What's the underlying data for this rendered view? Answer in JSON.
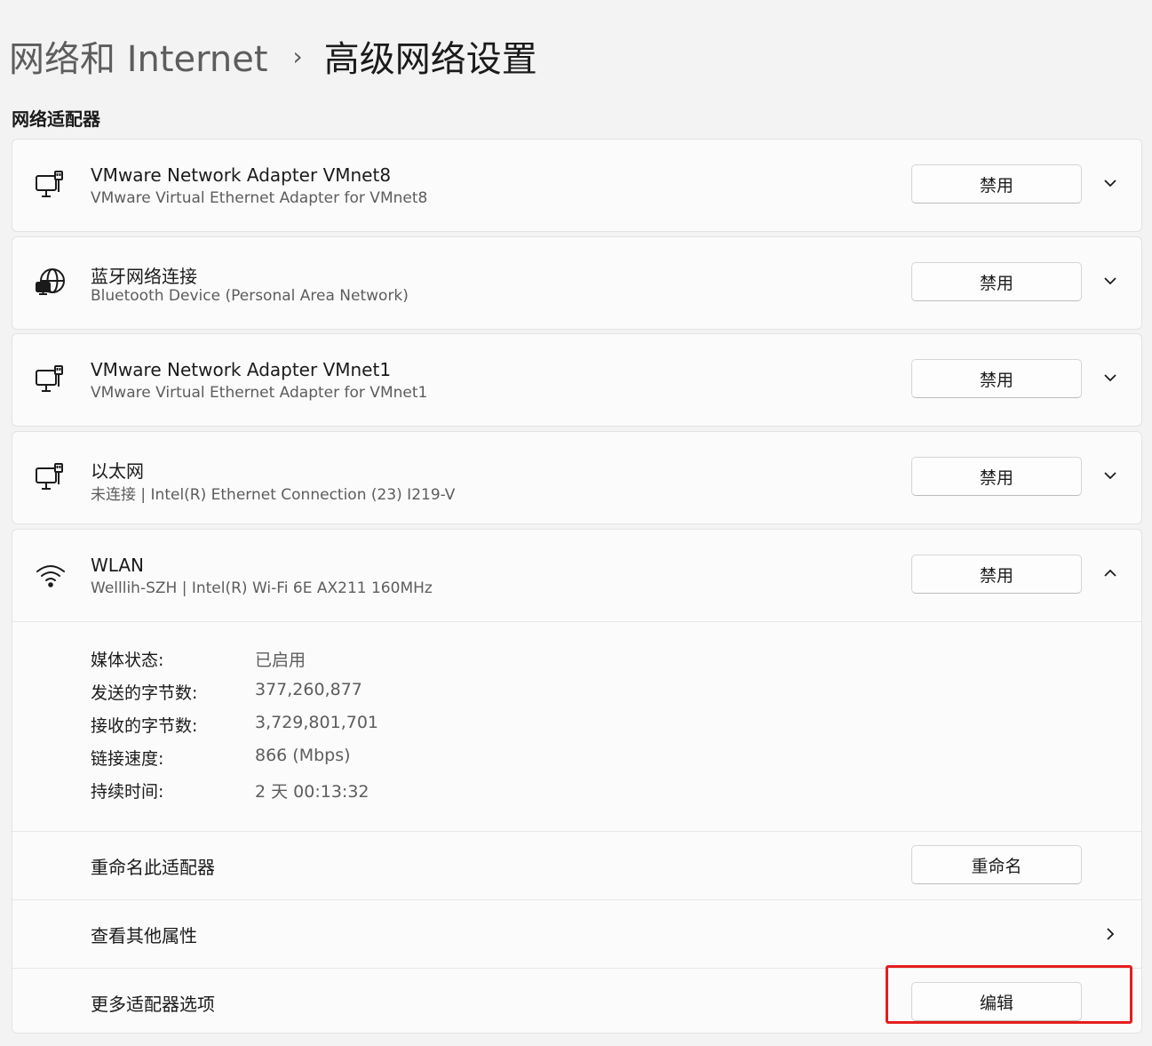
{
  "breadcrumb": {
    "parent": "网络和 Internet",
    "separator": "›",
    "current": "高级网络设置"
  },
  "section_label": "网络适配器",
  "adapters": [
    {
      "icon": "ethernet-adapter-icon",
      "title": "VMware Network Adapter VMnet8",
      "subtitle": "VMware Virtual Ethernet Adapter for VMnet8",
      "button": "禁用",
      "expanded": false
    },
    {
      "icon": "bluetooth-network-icon",
      "title": "蓝牙网络连接",
      "subtitle": "Bluetooth Device (Personal Area Network)",
      "button": "禁用",
      "expanded": false
    },
    {
      "icon": "ethernet-adapter-icon",
      "title": "VMware Network Adapter VMnet1",
      "subtitle": "VMware Virtual Ethernet Adapter for VMnet1",
      "button": "禁用",
      "expanded": false
    },
    {
      "icon": "ethernet-adapter-icon",
      "title": "以太网",
      "subtitle": "未连接 | Intel(R) Ethernet Connection (23) I219-V",
      "button": "禁用",
      "expanded": false
    },
    {
      "icon": "wifi-icon",
      "title": "WLAN",
      "subtitle": "Welllih-SZH | Intel(R) Wi-Fi 6E AX211 160MHz",
      "button": "禁用",
      "expanded": true
    }
  ],
  "wlan_details": [
    {
      "label": "媒体状态:",
      "value": "已启用"
    },
    {
      "label": "发送的字节数:",
      "value": "377,260,877"
    },
    {
      "label": "接收的字节数:",
      "value": "3,729,801,701"
    },
    {
      "label": "链接速度:",
      "value": "866 (Mbps)"
    },
    {
      "label": "持续时间:",
      "value": "2 天 00:13:32"
    }
  ],
  "wlan_actions": {
    "rename": {
      "label": "重命名此适配器",
      "button": "重命名"
    },
    "properties": {
      "label": "查看其他属性"
    },
    "more_options": {
      "label": "更多适配器选项",
      "button": "编辑"
    }
  },
  "colors": {
    "highlight": "#e51d1d",
    "background": "#f3f3f3",
    "card": "#fbfbfb"
  }
}
